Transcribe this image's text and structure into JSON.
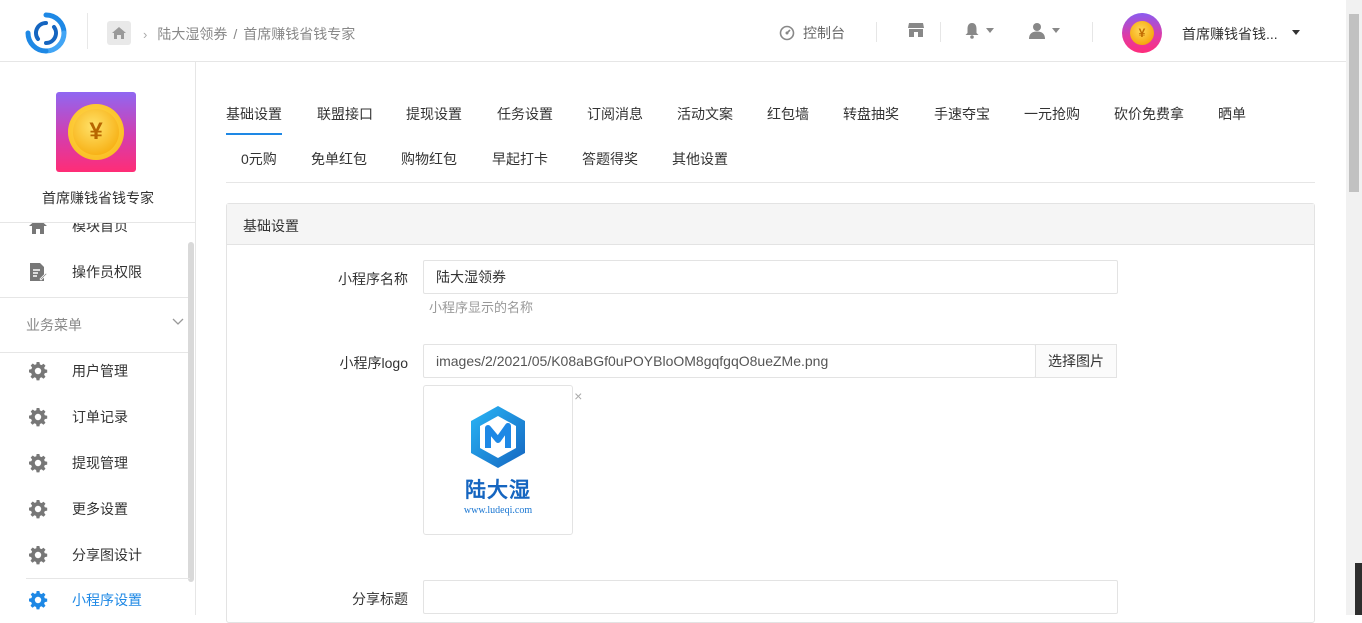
{
  "header": {
    "breadcrumb": [
      "陆大湿领券",
      "首席赚钱省钱专家"
    ],
    "breadcrumb_sep": "/",
    "console_label": "控制台",
    "user_name": "首席赚钱省钱...",
    "coin_symbol": "¥"
  },
  "sidebar": {
    "account_name": "首席赚钱省钱专家",
    "coin_symbol": "¥",
    "items_top": [
      {
        "label": "模块首页",
        "icon": "home-icon"
      },
      {
        "label": "操作员权限",
        "icon": "document-edit-icon"
      }
    ],
    "group_label": "业务菜单",
    "items": [
      {
        "label": "用户管理",
        "icon": "gear-icon"
      },
      {
        "label": "订单记录",
        "icon": "gear-icon"
      },
      {
        "label": "提现管理",
        "icon": "gear-icon"
      },
      {
        "label": "更多设置",
        "icon": "gear-icon"
      },
      {
        "label": "分享图设计",
        "icon": "gear-icon"
      },
      {
        "label": "小程序设置",
        "icon": "gear-icon",
        "active": true
      }
    ]
  },
  "tabs": {
    "row1": [
      "基础设置",
      "联盟接口",
      "提现设置",
      "任务设置",
      "订阅消息",
      "活动文案",
      "红包墙",
      "转盘抽奖",
      "手速夺宝",
      "一元抢购",
      "砍价免费拿",
      "晒单"
    ],
    "row2": [
      "0元购",
      "免单红包",
      "购物红包",
      "早起打卡",
      "答题得奖",
      "其他设置"
    ],
    "active": "基础设置"
  },
  "panel": {
    "title": "基础设置",
    "app_name_label": "小程序名称",
    "app_name_value": "陆大湿领券",
    "app_name_help": "小程序显示的名称",
    "logo_label": "小程序logo",
    "logo_value": "images/2/2021/05/K08aBGf0uPOYBloOM8gqfgqO8ueZMe.png",
    "logo_button": "选择图片",
    "logo_preview_title": "陆大湿",
    "logo_preview_url": "www.ludeqi.com",
    "remove_symbol": "×",
    "share_title_label": "分享标题",
    "share_title_value": ""
  },
  "colors": {
    "accent": "#1e88e5",
    "border": "#e3e3e3",
    "panel_head_bg": "#f5f5f5"
  }
}
